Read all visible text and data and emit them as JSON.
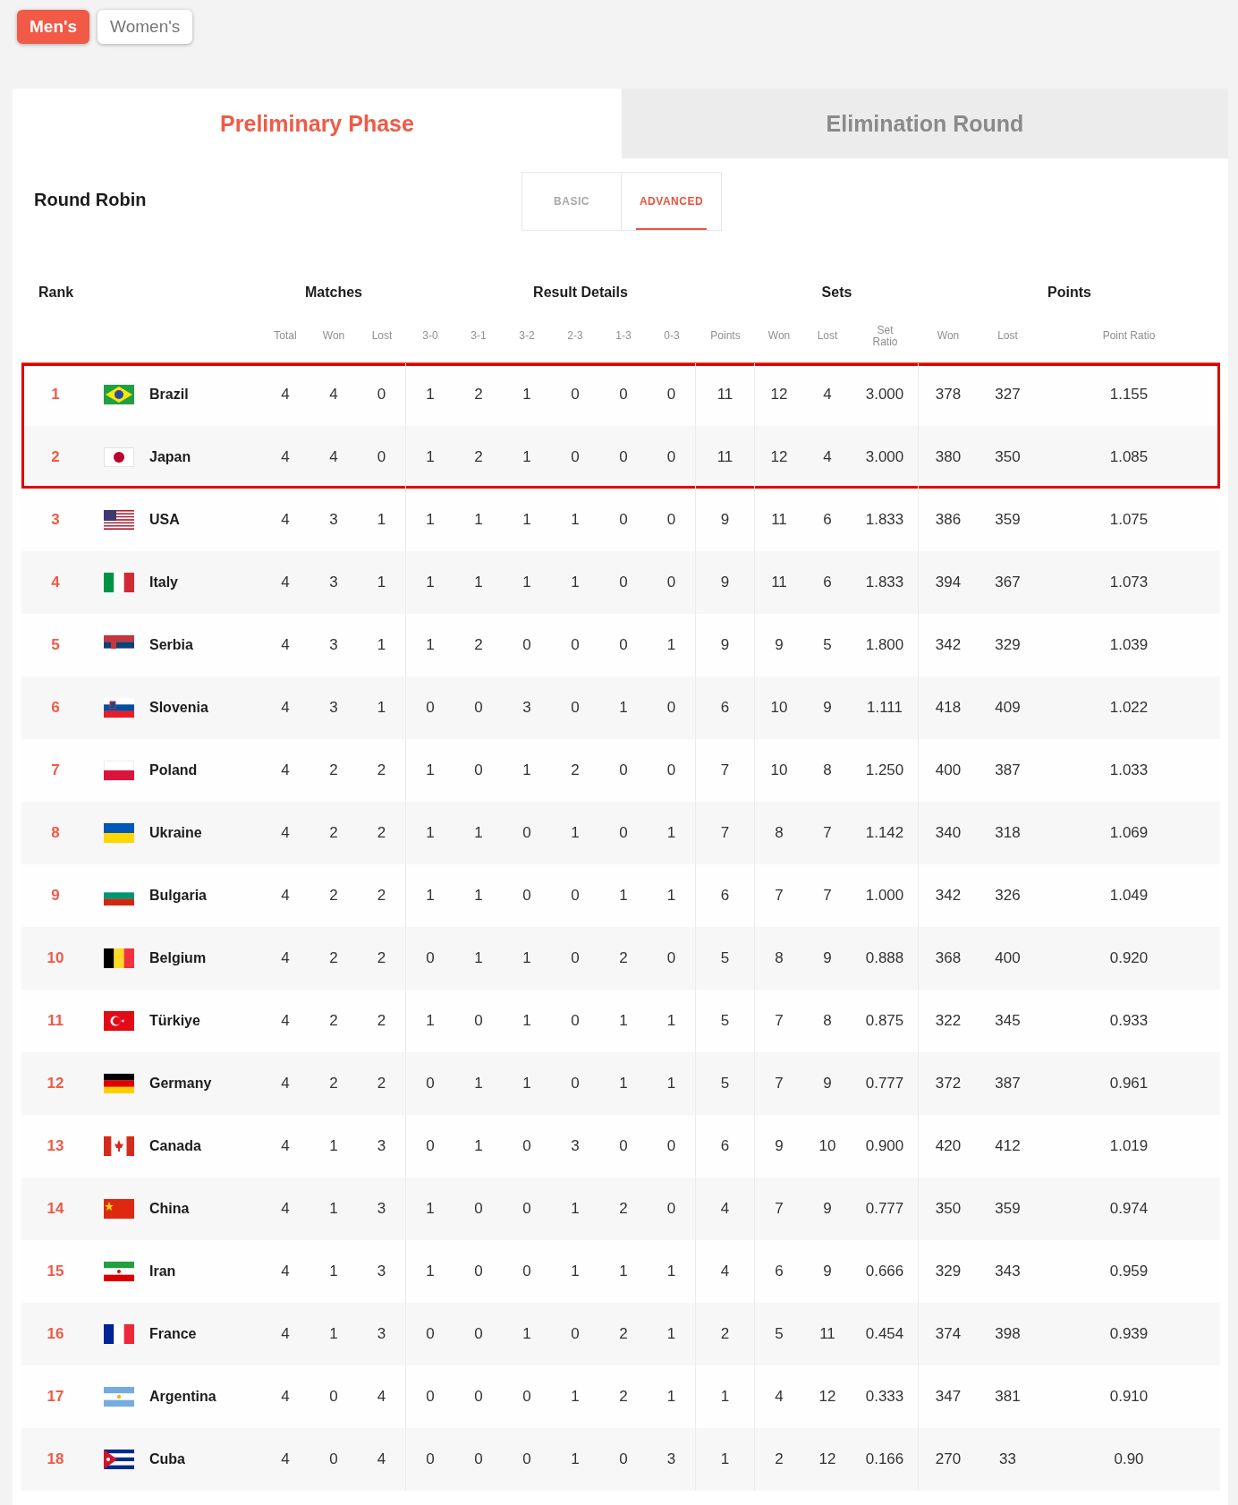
{
  "gender_tabs": [
    {
      "label": "Men's",
      "selected": true
    },
    {
      "label": "Women's",
      "selected": false
    }
  ],
  "phase_tabs": [
    {
      "label": "Preliminary Phase",
      "selected": true
    },
    {
      "label": "Elimination Round",
      "selected": false
    }
  ],
  "section_title": "Round Robin",
  "view_toggle": [
    {
      "label": "BASIC",
      "selected": false
    },
    {
      "label": "ADVANCED",
      "selected": true
    }
  ],
  "column_groups": [
    {
      "label": "Rank",
      "kind": "rank"
    },
    {
      "label": "Matches",
      "kind": "matches"
    },
    {
      "label": "Result Details",
      "kind": "results"
    },
    {
      "label": "Sets",
      "kind": "sets"
    },
    {
      "label": "Points",
      "kind": "points"
    }
  ],
  "columns": [
    "Total",
    "Won",
    "Lost",
    "3-0",
    "3-1",
    "3-2",
    "2-3",
    "1-3",
    "0-3",
    "Points",
    "Won",
    "Lost",
    "Set Ratio",
    "Won",
    "Lost",
    "Point Ratio"
  ],
  "rows": [
    {
      "rank": "1",
      "kind": "br",
      "country": "Brazil",
      "highlighted": true,
      "stats": [
        "4",
        "4",
        "0",
        "1",
        "2",
        "1",
        "0",
        "0",
        "0",
        "11",
        "12",
        "4",
        "3.000",
        "378",
        "327",
        "1.155"
      ]
    },
    {
      "rank": "2",
      "kind": "jp",
      "country": "Japan",
      "highlighted": true,
      "stats": [
        "4",
        "4",
        "0",
        "1",
        "2",
        "1",
        "0",
        "0",
        "0",
        "11",
        "12",
        "4",
        "3.000",
        "380",
        "350",
        "1.085"
      ]
    },
    {
      "rank": "3",
      "kind": "us",
      "country": "USA",
      "highlighted": false,
      "stats": [
        "4",
        "3",
        "1",
        "1",
        "1",
        "1",
        "1",
        "0",
        "0",
        "9",
        "11",
        "6",
        "1.833",
        "386",
        "359",
        "1.075"
      ]
    },
    {
      "rank": "4",
      "kind": "it",
      "country": "Italy",
      "highlighted": false,
      "stats": [
        "4",
        "3",
        "1",
        "1",
        "1",
        "1",
        "1",
        "0",
        "0",
        "9",
        "11",
        "6",
        "1.833",
        "394",
        "367",
        "1.073"
      ]
    },
    {
      "rank": "5",
      "kind": "rs",
      "country": "Serbia",
      "highlighted": false,
      "stats": [
        "4",
        "3",
        "1",
        "1",
        "2",
        "0",
        "0",
        "0",
        "1",
        "9",
        "9",
        "5",
        "1.800",
        "342",
        "329",
        "1.039"
      ]
    },
    {
      "rank": "6",
      "kind": "si",
      "country": "Slovenia",
      "highlighted": false,
      "stats": [
        "4",
        "3",
        "1",
        "0",
        "0",
        "3",
        "0",
        "1",
        "0",
        "6",
        "10",
        "9",
        "1.111",
        "418",
        "409",
        "1.022"
      ]
    },
    {
      "rank": "7",
      "kind": "pl",
      "country": "Poland",
      "highlighted": false,
      "stats": [
        "4",
        "2",
        "2",
        "1",
        "0",
        "1",
        "2",
        "0",
        "0",
        "7",
        "10",
        "8",
        "1.250",
        "400",
        "387",
        "1.033"
      ]
    },
    {
      "rank": "8",
      "kind": "ua",
      "country": "Ukraine",
      "highlighted": false,
      "stats": [
        "4",
        "2",
        "2",
        "1",
        "1",
        "0",
        "1",
        "0",
        "1",
        "7",
        "8",
        "7",
        "1.142",
        "340",
        "318",
        "1.069"
      ]
    },
    {
      "rank": "9",
      "kind": "bg",
      "country": "Bulgaria",
      "highlighted": false,
      "stats": [
        "4",
        "2",
        "2",
        "1",
        "1",
        "0",
        "0",
        "1",
        "1",
        "6",
        "7",
        "7",
        "1.000",
        "342",
        "326",
        "1.049"
      ]
    },
    {
      "rank": "10",
      "kind": "be",
      "country": "Belgium",
      "highlighted": false,
      "stats": [
        "4",
        "2",
        "2",
        "0",
        "1",
        "1",
        "0",
        "2",
        "0",
        "5",
        "8",
        "9",
        "0.888",
        "368",
        "400",
        "0.920"
      ]
    },
    {
      "rank": "11",
      "kind": "tr",
      "country": "Türkiye",
      "highlighted": false,
      "stats": [
        "4",
        "2",
        "2",
        "1",
        "0",
        "1",
        "0",
        "1",
        "1",
        "5",
        "7",
        "8",
        "0.875",
        "322",
        "345",
        "0.933"
      ]
    },
    {
      "rank": "12",
      "kind": "de",
      "country": "Germany",
      "highlighted": false,
      "stats": [
        "4",
        "2",
        "2",
        "0",
        "1",
        "1",
        "0",
        "1",
        "1",
        "5",
        "7",
        "9",
        "0.777",
        "372",
        "387",
        "0.961"
      ]
    },
    {
      "rank": "13",
      "kind": "ca",
      "country": "Canada",
      "highlighted": false,
      "stats": [
        "4",
        "1",
        "3",
        "0",
        "1",
        "0",
        "3",
        "0",
        "0",
        "6",
        "9",
        "10",
        "0.900",
        "420",
        "412",
        "1.019"
      ]
    },
    {
      "rank": "14",
      "kind": "cn",
      "country": "China",
      "highlighted": false,
      "stats": [
        "4",
        "1",
        "3",
        "1",
        "0",
        "0",
        "1",
        "2",
        "0",
        "4",
        "7",
        "9",
        "0.777",
        "350",
        "359",
        "0.974"
      ]
    },
    {
      "rank": "15",
      "kind": "ir",
      "country": "Iran",
      "highlighted": false,
      "stats": [
        "4",
        "1",
        "3",
        "1",
        "0",
        "0",
        "1",
        "1",
        "1",
        "4",
        "6",
        "9",
        "0.666",
        "329",
        "343",
        "0.959"
      ]
    },
    {
      "rank": "16",
      "kind": "fr",
      "country": "France",
      "highlighted": false,
      "stats": [
        "4",
        "1",
        "3",
        "0",
        "0",
        "1",
        "0",
        "2",
        "1",
        "2",
        "5",
        "11",
        "0.454",
        "374",
        "398",
        "0.939"
      ]
    },
    {
      "rank": "17",
      "kind": "ar",
      "country": "Argentina",
      "highlighted": false,
      "stats": [
        "4",
        "0",
        "4",
        "0",
        "0",
        "0",
        "1",
        "2",
        "1",
        "1",
        "4",
        "12",
        "0.333",
        "347",
        "381",
        "0.910"
      ]
    },
    {
      "rank": "18",
      "kind": "cu",
      "country": "Cuba",
      "highlighted": false,
      "stats": [
        "4",
        "0",
        "4",
        "0",
        "0",
        "0",
        "1",
        "0",
        "3",
        "1",
        "2",
        "12",
        "0.166",
        "270",
        "33",
        "0.90"
      ]
    }
  ]
}
